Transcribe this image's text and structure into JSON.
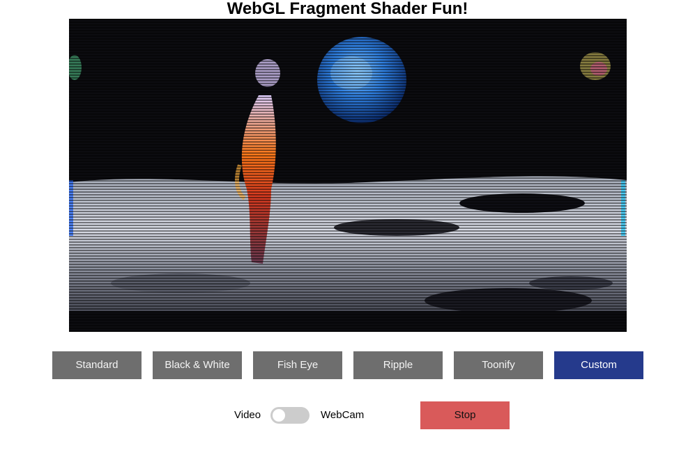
{
  "page": {
    "title": "WebGL Fragment Shader Fun!"
  },
  "shader_buttons": [
    {
      "label": "Standard",
      "active": false
    },
    {
      "label": "Black & White",
      "active": false
    },
    {
      "label": "Fish Eye",
      "active": false
    },
    {
      "label": "Ripple",
      "active": false
    },
    {
      "label": "Toonify",
      "active": false
    },
    {
      "label": "Custom",
      "active": true
    }
  ],
  "source_toggle": {
    "left_label": "Video",
    "right_label": "WebCam",
    "selected": "Video"
  },
  "stop_button": {
    "label": "Stop"
  },
  "colors": {
    "button_default": "#6e6e6e",
    "button_active": "#253a8c",
    "stop_button": "#d95a5a",
    "toggle_track": "#cccccc"
  }
}
